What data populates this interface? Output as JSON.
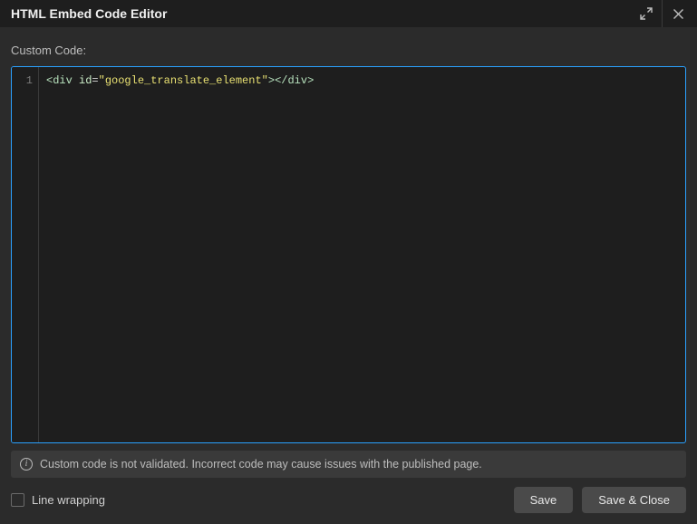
{
  "titlebar": {
    "title": "HTML Embed Code Editor"
  },
  "label": "Custom Code:",
  "editor": {
    "line_numbers": [
      "1"
    ],
    "tokens": {
      "open_lt": "<",
      "tag_div_open": "div",
      "space": " ",
      "attr_id": "id",
      "eq": "=",
      "str_id": "\"google_translate_element\"",
      "open_gt": ">",
      "close_lt": "</",
      "tag_div_close": "div",
      "close_gt": ">"
    }
  },
  "notice": {
    "text": "Custom code is not validated. Incorrect code may cause issues with the published page."
  },
  "footer": {
    "line_wrapping_label": "Line wrapping",
    "line_wrapping_checked": false,
    "save_label": "Save",
    "save_close_label": "Save & Close"
  }
}
